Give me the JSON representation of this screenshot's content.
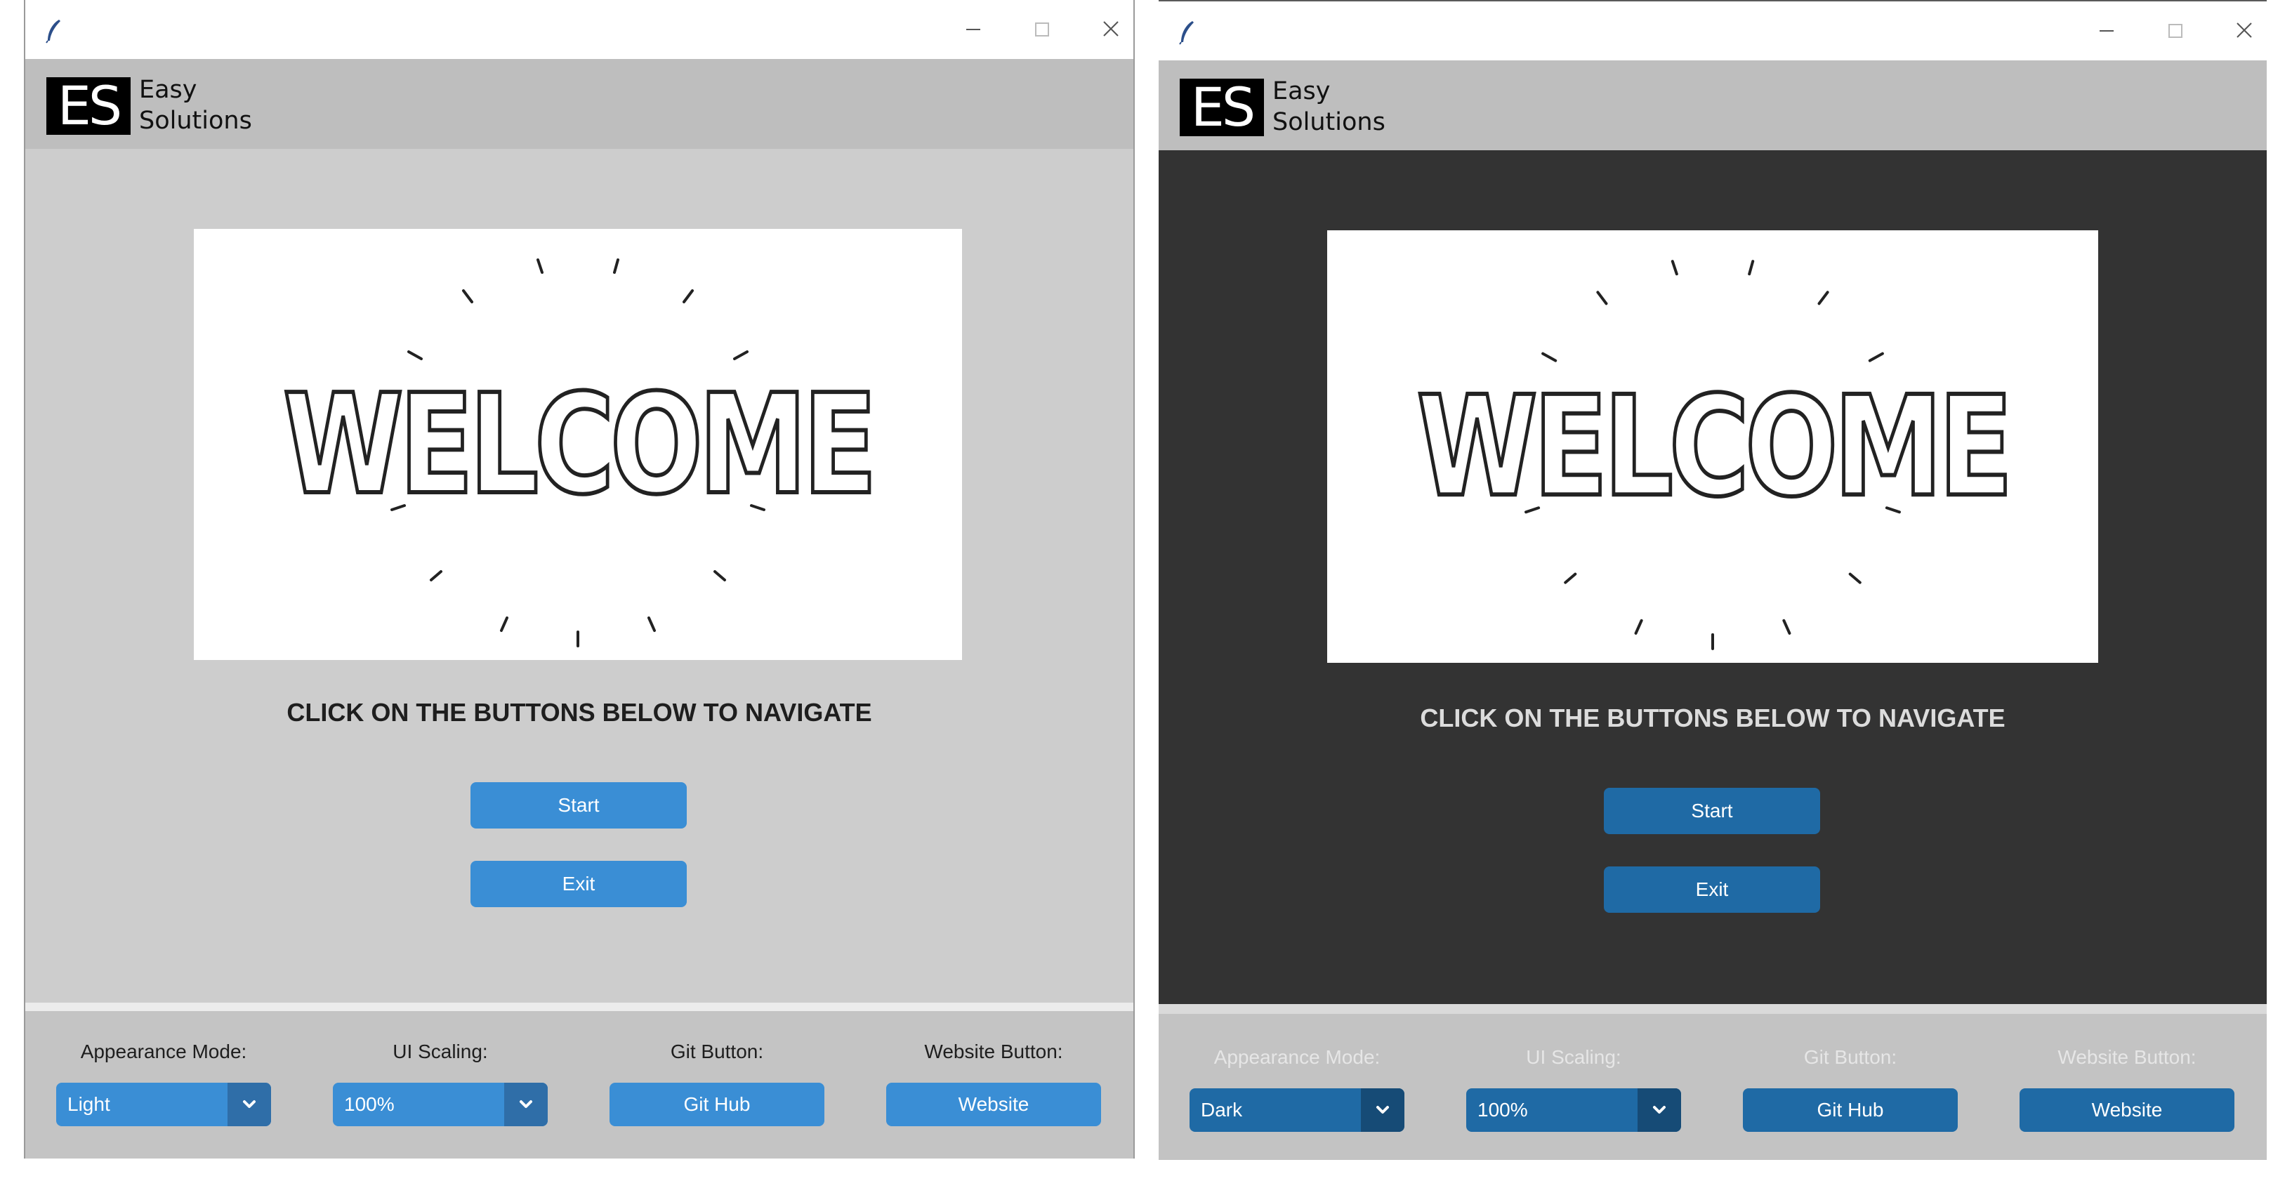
{
  "windows": [
    {
      "id": "light",
      "brand": {
        "logo_text": "ES",
        "line1": "Easy",
        "line2": "Solutions"
      },
      "welcome_image_text": "WELCOME",
      "instruction": "CLICK ON THE BUTTONS BELOW TO NAVIGATE",
      "buttons": {
        "start": "Start",
        "exit": "Exit"
      },
      "footer": {
        "appearance_label": "Appearance Mode:",
        "appearance_value": "Light",
        "scaling_label": "UI Scaling:",
        "scaling_value": "100%",
        "git_label": "Git Button:",
        "git_button": "Git Hub",
        "website_label": "Website Button:",
        "website_button": "Website"
      }
    },
    {
      "id": "dark",
      "brand": {
        "logo_text": "ES",
        "line1": "Easy",
        "line2": "Solutions"
      },
      "welcome_image_text": "WELCOME",
      "instruction": "CLICK ON THE BUTTONS BELOW TO NAVIGATE",
      "buttons": {
        "start": "Start",
        "exit": "Exit"
      },
      "footer": {
        "appearance_label": "Appearance Mode:",
        "appearance_value": "Dark",
        "scaling_label": "UI Scaling:",
        "scaling_value": "100%",
        "git_label": "Git Button:",
        "git_button": "Git Hub",
        "website_label": "Website Button:",
        "website_button": "Website"
      }
    }
  ],
  "colors": {
    "light_content_bg": "#cdcdcd",
    "dark_content_bg": "#333333",
    "light_button": "#3a8ed5",
    "dark_button": "#1f6aa5",
    "header_bg": "#bebebe"
  },
  "icons": [
    "feather-icon",
    "minimize-icon",
    "maximize-icon",
    "close-icon",
    "chevron-down-icon"
  ]
}
